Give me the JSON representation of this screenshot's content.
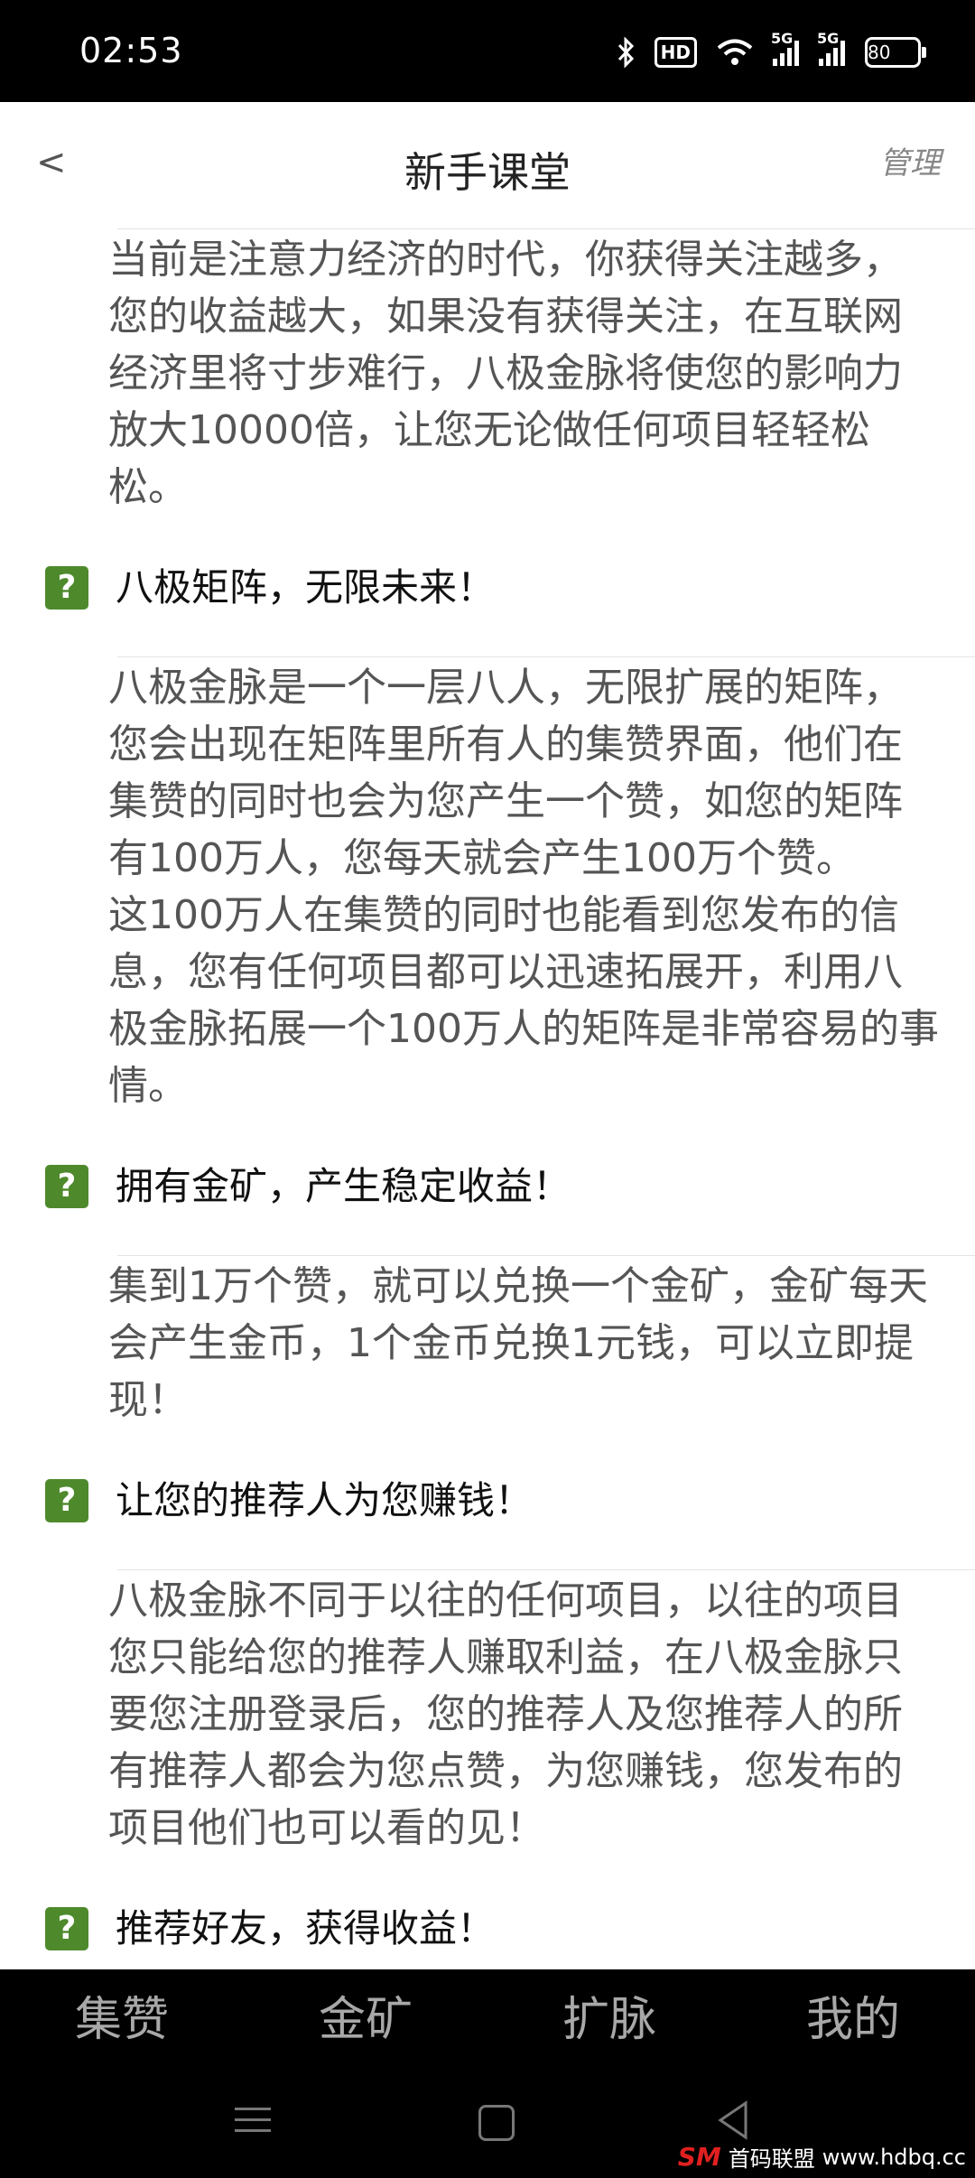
{
  "status_bar": {
    "time": "02:53",
    "hd_label": "HD",
    "signal1_label": "5G",
    "signal2_label": "5G",
    "battery": "80",
    "icons": [
      "bluetooth-icon",
      "hd-icon",
      "wifi-icon",
      "signal-5g-icon",
      "signal-5g-icon",
      "battery-icon"
    ]
  },
  "header": {
    "back": "<",
    "title": "新手课堂",
    "manage": "管理"
  },
  "intro": "当前是注意力经济的时代，你获得关注越多，您的收益越大，如果没有获得关注，在互联网经济里将寸步难行，八极金脉将使您的影响力放大10000倍，让您无论做任何项目轻轻松松。",
  "sections": [
    {
      "title": "八极矩阵，无限未来！",
      "body": "八极金脉是一个一层八人，无限扩展的矩阵，您会出现在矩阵里所有人的集赞界面，他们在集赞的同时也会为您产生一个赞，如您的矩阵有100万人，您每天就会产生100万个赞。\n这100万人在集赞的同时也能看到您发布的信息，您有任何项目都可以迅速拓展开，利用八极金脉拓展一个100万人的矩阵是非常容易的事情。"
    },
    {
      "title": "拥有金矿，产生稳定收益！",
      "body": "集到1万个赞，就可以兑换一个金矿，金矿每天会产生金币，1个金币兑换1元钱，可以立即提现！"
    },
    {
      "title": "让您的推荐人为您赚钱！",
      "body": "八极金脉不同于以往的任何项目，以往的项目您只能给您的推荐人赚取利益，在八极金脉只要您注册登录后，您的推荐人及您推荐人的所有推荐人都会为您点赞，为您赚钱，您发布的项目他们也可以看的见！"
    },
    {
      "title": "推荐好友，获得收益！",
      "body": ""
    }
  ],
  "question_icon": "?",
  "bottom_nav": {
    "items": [
      "集赞",
      "金矿",
      "扩脉",
      "我的"
    ]
  },
  "watermark": {
    "logo": "SM",
    "text": "首码联盟",
    "url": "www.hdbq.cc"
  },
  "colors": {
    "accent_green": "#4e8a2c",
    "status_bg": "#000000",
    "nav_text": "#a8a8a8"
  }
}
